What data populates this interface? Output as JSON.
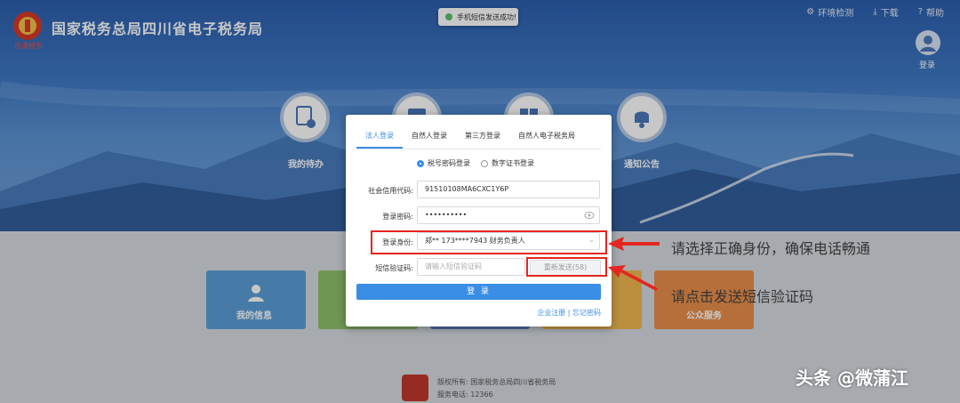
{
  "header": {
    "title": "国家税务总局四川省电子税务局",
    "logo_text": "乐道税务",
    "nav": [
      {
        "icon": "wrench-icon",
        "label": "环境检测"
      },
      {
        "icon": "download-icon",
        "label": "下载"
      },
      {
        "icon": "help-icon",
        "label": "帮助"
      }
    ],
    "user_label": "登录"
  },
  "toast": {
    "text": "手机短信发送成功!"
  },
  "quick_circles": [
    {
      "icon": "todo-icon",
      "label": "我的待办"
    },
    {
      "icon": "calendar-icon",
      "label": ""
    },
    {
      "icon": "book-icon",
      "label": ""
    },
    {
      "icon": "bell-icon",
      "label": "通知公告"
    }
  ],
  "tiles": [
    {
      "label": "我的信息",
      "color": "#5a9ed6"
    },
    {
      "label": "",
      "color": "#8fc06b"
    },
    {
      "label": "",
      "color": "#5f7fc8"
    },
    {
      "label": "",
      "color": "#f0b850"
    },
    {
      "label": "",
      "color": "#eea06a"
    },
    {
      "label": "公众服务",
      "color": "#e98f4a"
    }
  ],
  "login": {
    "tabs": [
      "法人登录",
      "自然人登录",
      "第三方登录",
      "自然人电子税务局"
    ],
    "active_tab": 0,
    "radio": [
      {
        "label": "税号密码登录",
        "checked": true
      },
      {
        "label": "数字证书登录",
        "checked": false
      }
    ],
    "credit_code_label": "社会信用代码:",
    "credit_code_value": "91510108MA6CXC1Y6P",
    "password_label": "登录密码:",
    "password_value": "••••••••••",
    "identity_label": "登录身份:",
    "identity_value": "郑** 173****7943 财务负责人",
    "sms_label": "短信验证码:",
    "sms_placeholder": "请输入短信验证码",
    "resend_label": "重新发送(58)",
    "login_button": "登 录",
    "link_register": "企业注册",
    "link_separator": "|",
    "link_forgot": "忘记密码"
  },
  "annotations": {
    "note1": "请选择正确身份，确保电话畅通",
    "note2": "请点击发送短信验证码"
  },
  "footer": {
    "copyright": "版权所有: 国家税务总局四川省税务局",
    "phone": "服务电话: 12366"
  },
  "watermark": "头条 @微蒲江",
  "colors": {
    "accent": "#3a8ee6",
    "highlight": "#e3261f"
  }
}
